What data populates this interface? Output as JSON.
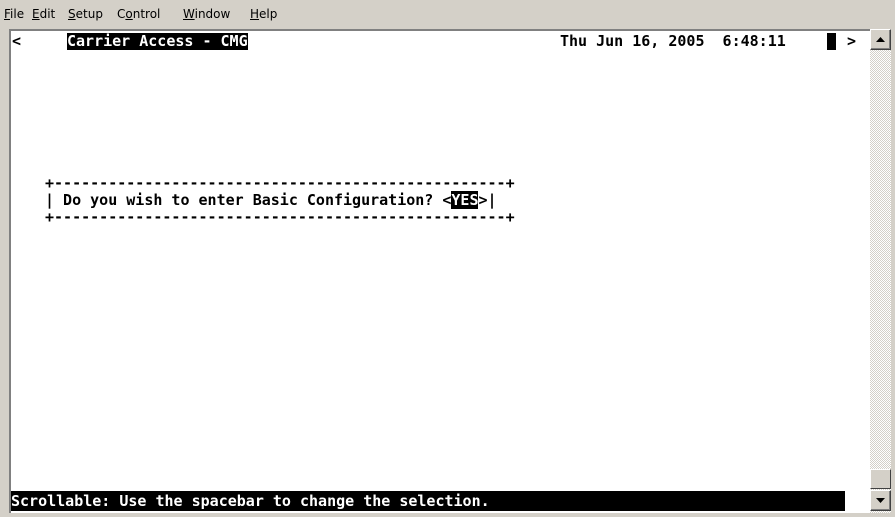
{
  "menu": [
    "File",
    "Edit",
    "Setup",
    "Control",
    "Window",
    "Help"
  ],
  "menu_mnemonics": [
    "F",
    "E",
    "S",
    "o",
    "W",
    "H"
  ],
  "terminal": {
    "left_arrow": "<",
    "title": "Carrier Access - CMG",
    "datetime": "Thu Jun 16, 2005  6:48:11",
    "right_arrow": ">",
    "dialog_top": "+--------------------------------------------------+",
    "dialog_prefix": "| Do you wish to enter Basic Configuration? <",
    "dialog_selected": "YES",
    "dialog_suffix": ">|",
    "dialog_bottom": "+--------------------------------------------------+",
    "status_line": "Scrollable: Use the spacebar to change the selection."
  },
  "scrollbar": {
    "up_icon": "scroll-up-arrow",
    "down_icon": "scroll-down-arrow"
  }
}
